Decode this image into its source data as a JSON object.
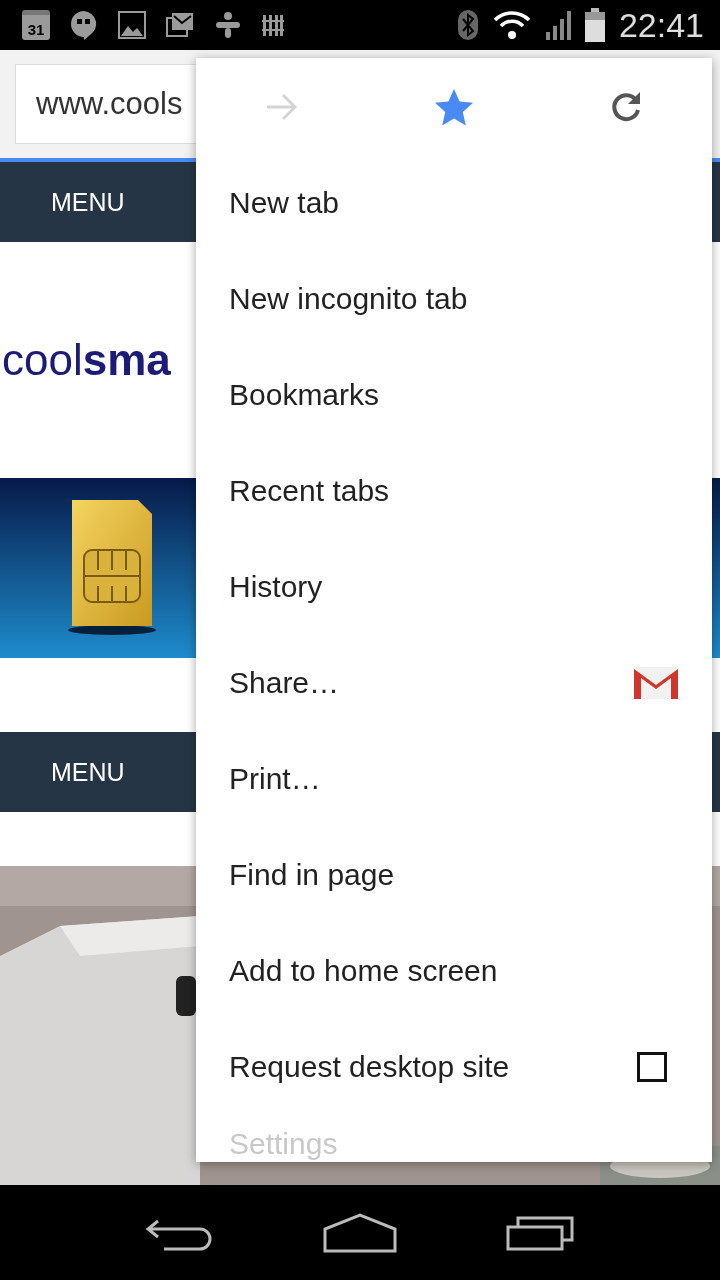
{
  "status_bar": {
    "calendar_day": "31",
    "time": "22:41"
  },
  "address_bar": {
    "url": "www.cools"
  },
  "page": {
    "nav_top": "MENU",
    "logo": "cool**sma**",
    "nav_bottom": "MENU"
  },
  "menu": {
    "actions": [
      {
        "kind": "forward",
        "disabled": true,
        "on": false
      },
      {
        "kind": "bookmark",
        "disabled": false,
        "on": true
      },
      {
        "kind": "reload",
        "disabled": false,
        "on": false
      }
    ],
    "items": [
      {
        "kind": "plain",
        "label": "New tab"
      },
      {
        "kind": "plain",
        "label": "New incognito tab"
      },
      {
        "kind": "plain",
        "label": "Bookmarks"
      },
      {
        "kind": "plain",
        "label": "Recent tabs"
      },
      {
        "kind": "plain",
        "label": "History"
      },
      {
        "kind": "share",
        "label": "Share…"
      },
      {
        "kind": "plain",
        "label": "Print…"
      },
      {
        "kind": "plain",
        "label": "Find in page"
      },
      {
        "kind": "plain",
        "label": "Add to home screen"
      },
      {
        "kind": "checkbox",
        "label": "Request desktop site",
        "checked": false
      },
      {
        "kind": "plain",
        "label": "Settings"
      }
    ]
  }
}
